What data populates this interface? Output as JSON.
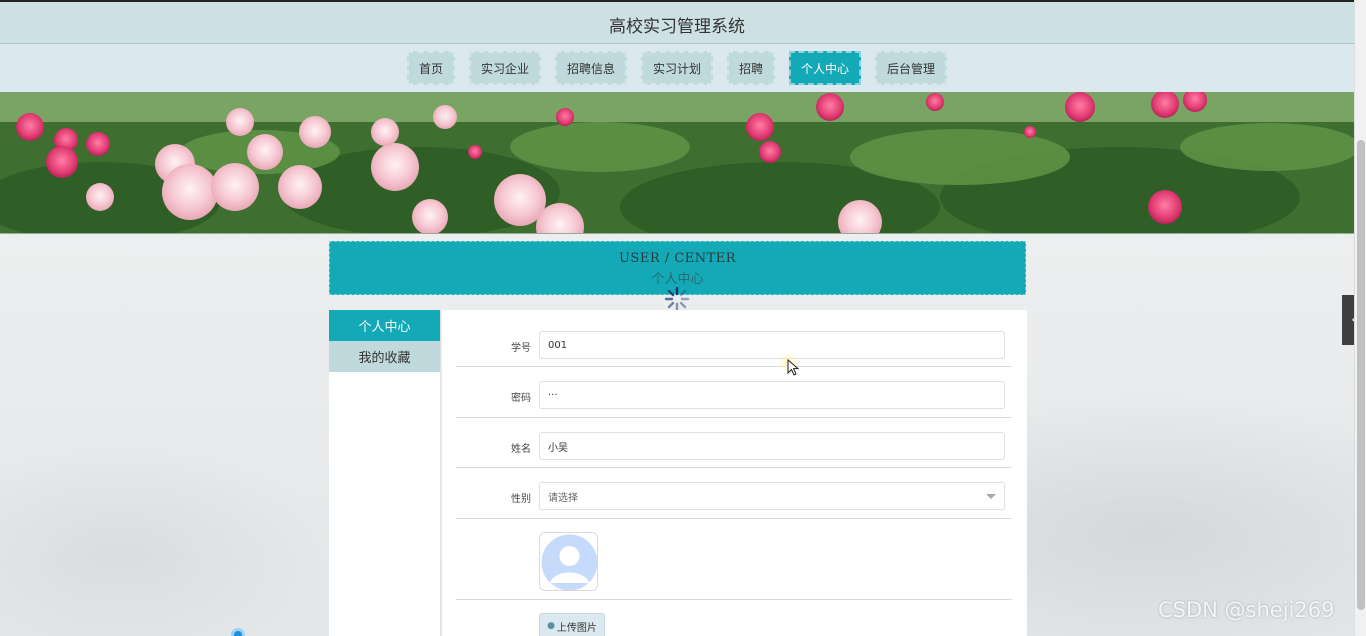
{
  "header": {
    "site_title": "高校实习管理系统"
  },
  "nav": {
    "items": [
      {
        "label": "首页"
      },
      {
        "label": "实习企业"
      },
      {
        "label": "招聘信息"
      },
      {
        "label": "实习计划"
      },
      {
        "label": "招聘"
      },
      {
        "label": "个人中心"
      },
      {
        "label": "后台管理"
      }
    ],
    "active_index": 5
  },
  "center_header": {
    "title_en": "USER / CENTER",
    "title_cn": "个人中心"
  },
  "sidebar": {
    "items": [
      {
        "label": "个人中心"
      },
      {
        "label": "我的收藏"
      }
    ],
    "active_index": 0
  },
  "form": {
    "fields": [
      {
        "label": "学号",
        "value": "001"
      },
      {
        "label": "密码",
        "value": "···"
      },
      {
        "label": "姓名",
        "value": "小吴"
      },
      {
        "label": "性别",
        "placeholder": "请选择"
      }
    ],
    "upload_label": "上传图片"
  },
  "side_tab": {
    "icon": "chevron-left-icon"
  },
  "watermark": "CSDN @sheji269",
  "colors": {
    "accent": "#13a9b7",
    "nav_bg": "#bfd9dc",
    "topbar_bg": "#cde0e4"
  }
}
